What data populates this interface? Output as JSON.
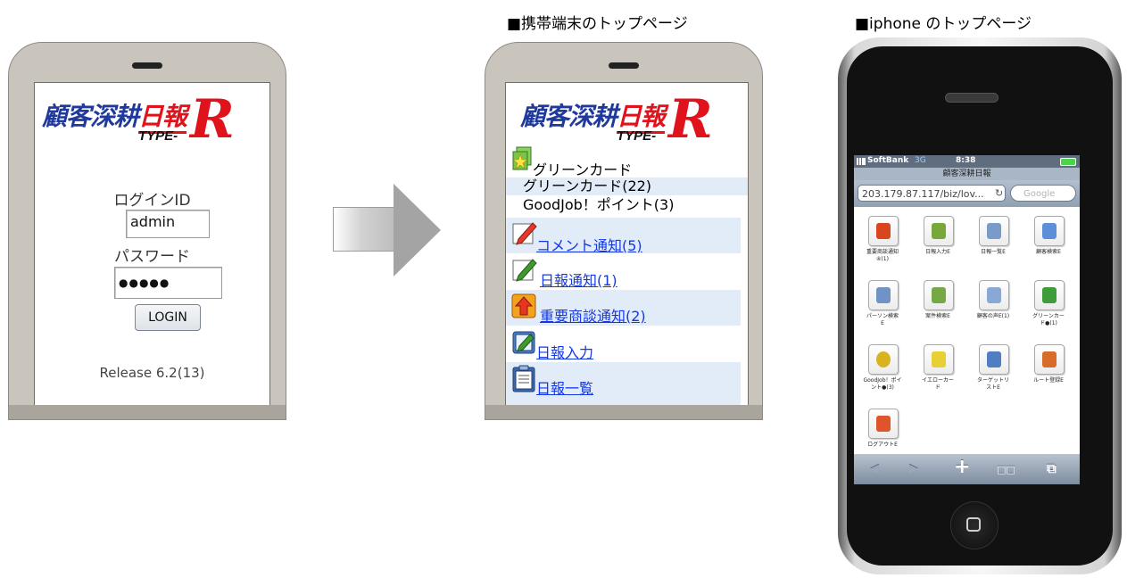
{
  "captions": {
    "mobile_top": "■携帯端末のトップページ",
    "iphone_top": "■iphone のトップページ"
  },
  "logo": {
    "main_blue": "顧客深耕",
    "main_red": "日報",
    "type": "TYPE-",
    "r": "R"
  },
  "login": {
    "id_label": "ログインID",
    "id_value": "admin",
    "password_label": "パスワード",
    "password_value": "●●●●●",
    "button": "LOGIN",
    "release": "Release 6.2(13)"
  },
  "menu": {
    "green_card_header": "グリーンカード",
    "green_card_count": "グリーンカード(22)",
    "goodjob": "GoodJob！ポイント(3)",
    "items": [
      {
        "label": "コメント通知(5)",
        "icon": "pencil-red-icon"
      },
      {
        "label": "日報通知(1)",
        "icon": "pencil-green-icon"
      },
      {
        "label": "重要商談通知(2)",
        "icon": "up-arrow-icon"
      },
      {
        "label": "日報入力",
        "icon": "notebook-icon"
      },
      {
        "label": "日報一覧",
        "icon": "clipboard-icon"
      }
    ]
  },
  "iphone": {
    "carrier": "SoftBank",
    "network": "3G",
    "time": "8:38",
    "page_title": "顧客深耕日報",
    "url": "203.179.87.117/biz/lov...",
    "search_placeholder": "Google",
    "tiles": [
      {
        "label": "重要商談通知\n④(1)",
        "color": "#d9461e"
      },
      {
        "label": "日報入力E",
        "color": "#79a83a"
      },
      {
        "label": "日報一覧E",
        "color": "#7a9bc9"
      },
      {
        "label": "顧客検索E",
        "color": "#5d8fd8"
      },
      {
        "label": "パーソン検索\nE",
        "color": "#6f93c4"
      },
      {
        "label": "案件検索E",
        "color": "#76a845"
      },
      {
        "label": "顧客の声E(1)",
        "color": "#8aa8d6"
      },
      {
        "label": "グリーンカー\nド●(1)",
        "color": "#3f9c3a"
      },
      {
        "label": "GoodJob！ポイ\nント●(3)",
        "color": "#d8b320"
      },
      {
        "label": "イエローカー\nド",
        "color": "#e8cf34"
      },
      {
        "label": "ターゲットリ\nストE",
        "color": "#4f7fc2"
      },
      {
        "label": "ルート登録E",
        "color": "#d76d28"
      },
      {
        "label": "ログアウトE",
        "color": "#e0542b"
      }
    ],
    "toolbar": {
      "back": "◀",
      "forward": "▶",
      "add": "+",
      "bookmarks": "□□",
      "pages": "⧉"
    }
  }
}
